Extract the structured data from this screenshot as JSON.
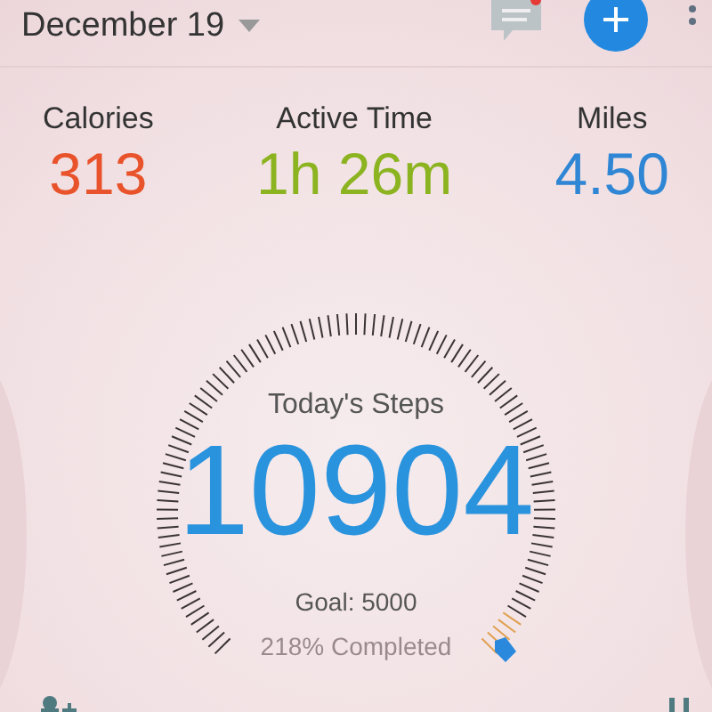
{
  "header": {
    "date": "December 19",
    "notification": true
  },
  "stats": [
    {
      "label": "Calories",
      "value": "313",
      "color": "#e8532b"
    },
    {
      "label": "Active Time",
      "value": "1h 26m",
      "color": "#8cb320"
    },
    {
      "label": "Miles",
      "value": "4.50",
      "color": "#2f86d4"
    }
  ],
  "steps": {
    "title": "Today's Steps",
    "count": "10904",
    "goal": "Goal: 5000",
    "completed": "218% Completed"
  }
}
